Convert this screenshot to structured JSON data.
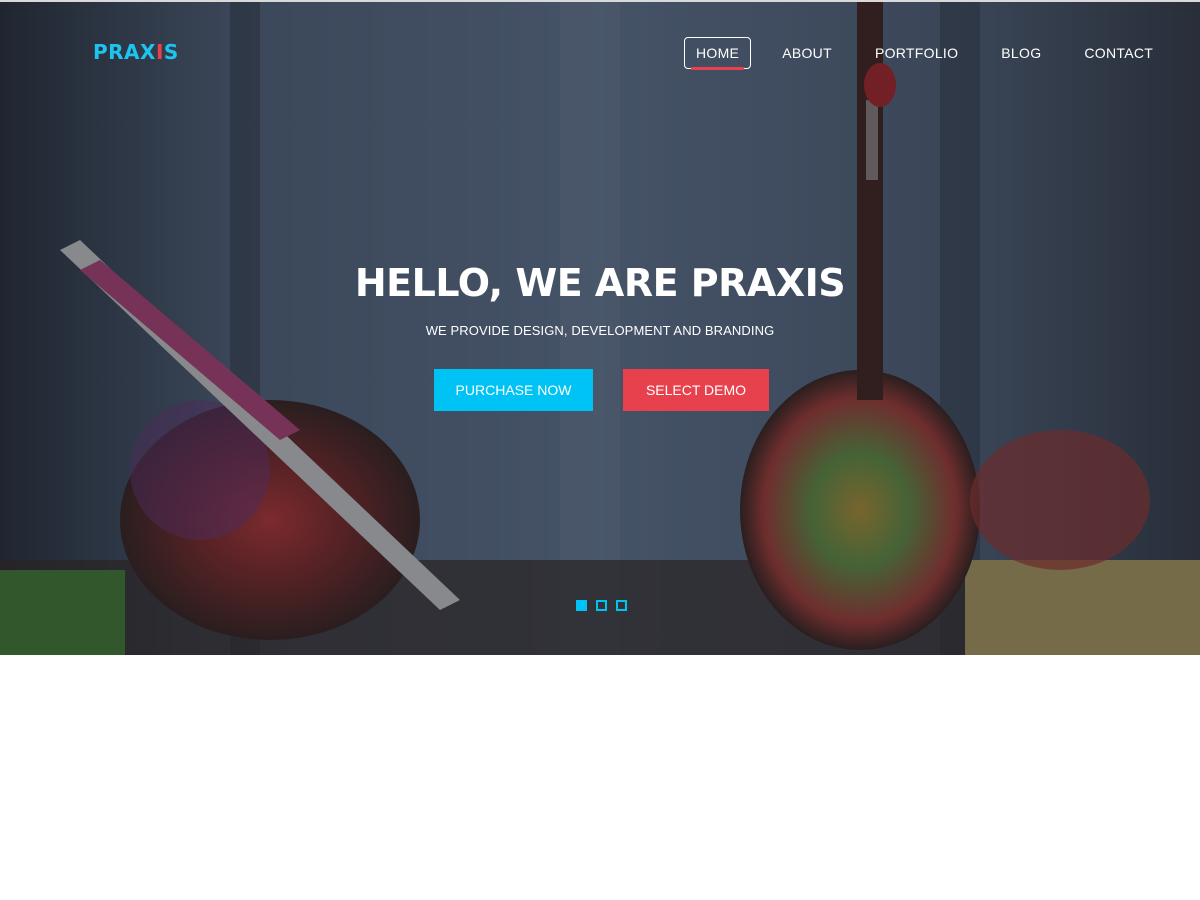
{
  "brand": {
    "logo_part1": "PRAX",
    "logo_accent": "I",
    "logo_part2": "S",
    "primary_color": "#1ec4f0",
    "accent_color": "#e8414e"
  },
  "nav": {
    "items": [
      {
        "label": "HOME",
        "active": true
      },
      {
        "label": "ABOUT",
        "active": false
      },
      {
        "label": "PORTFOLIO",
        "active": false
      },
      {
        "label": "BLOG",
        "active": false
      },
      {
        "label": "CONTACT",
        "active": false
      }
    ]
  },
  "hero": {
    "title": "HELLO, WE ARE PRAXIS",
    "subtitle": "WE PROVIDE DESIGN, DEVELOPMENT AND BRANDING",
    "purchase_label": "PURCHASE NOW",
    "demo_label": "SELECT DEMO",
    "background_description_icon": "painting-hands-photo",
    "slides": {
      "count": 3,
      "active_index": 0
    }
  }
}
